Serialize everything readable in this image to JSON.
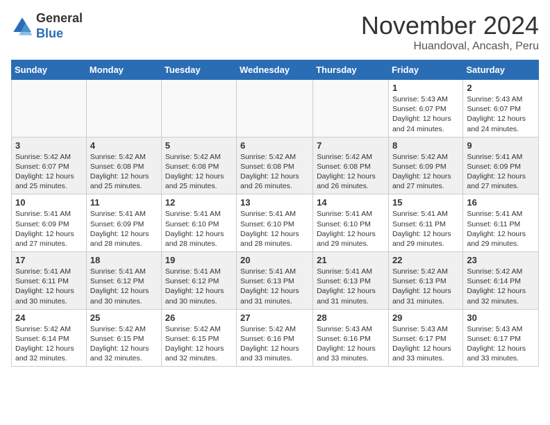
{
  "logo": {
    "general": "General",
    "blue": "Blue"
  },
  "title": "November 2024",
  "location": "Huandoval, Ancash, Peru",
  "weekdays": [
    "Sunday",
    "Monday",
    "Tuesday",
    "Wednesday",
    "Thursday",
    "Friday",
    "Saturday"
  ],
  "weeks": [
    [
      {
        "day": "",
        "info": ""
      },
      {
        "day": "",
        "info": ""
      },
      {
        "day": "",
        "info": ""
      },
      {
        "day": "",
        "info": ""
      },
      {
        "day": "",
        "info": ""
      },
      {
        "day": "1",
        "info": "Sunrise: 5:43 AM\nSunset: 6:07 PM\nDaylight: 12 hours and 24 minutes."
      },
      {
        "day": "2",
        "info": "Sunrise: 5:43 AM\nSunset: 6:07 PM\nDaylight: 12 hours and 24 minutes."
      }
    ],
    [
      {
        "day": "3",
        "info": "Sunrise: 5:42 AM\nSunset: 6:07 PM\nDaylight: 12 hours and 25 minutes."
      },
      {
        "day": "4",
        "info": "Sunrise: 5:42 AM\nSunset: 6:08 PM\nDaylight: 12 hours and 25 minutes."
      },
      {
        "day": "5",
        "info": "Sunrise: 5:42 AM\nSunset: 6:08 PM\nDaylight: 12 hours and 25 minutes."
      },
      {
        "day": "6",
        "info": "Sunrise: 5:42 AM\nSunset: 6:08 PM\nDaylight: 12 hours and 26 minutes."
      },
      {
        "day": "7",
        "info": "Sunrise: 5:42 AM\nSunset: 6:08 PM\nDaylight: 12 hours and 26 minutes."
      },
      {
        "day": "8",
        "info": "Sunrise: 5:42 AM\nSunset: 6:09 PM\nDaylight: 12 hours and 27 minutes."
      },
      {
        "day": "9",
        "info": "Sunrise: 5:41 AM\nSunset: 6:09 PM\nDaylight: 12 hours and 27 minutes."
      }
    ],
    [
      {
        "day": "10",
        "info": "Sunrise: 5:41 AM\nSunset: 6:09 PM\nDaylight: 12 hours and 27 minutes."
      },
      {
        "day": "11",
        "info": "Sunrise: 5:41 AM\nSunset: 6:09 PM\nDaylight: 12 hours and 28 minutes."
      },
      {
        "day": "12",
        "info": "Sunrise: 5:41 AM\nSunset: 6:10 PM\nDaylight: 12 hours and 28 minutes."
      },
      {
        "day": "13",
        "info": "Sunrise: 5:41 AM\nSunset: 6:10 PM\nDaylight: 12 hours and 28 minutes."
      },
      {
        "day": "14",
        "info": "Sunrise: 5:41 AM\nSunset: 6:10 PM\nDaylight: 12 hours and 29 minutes."
      },
      {
        "day": "15",
        "info": "Sunrise: 5:41 AM\nSunset: 6:11 PM\nDaylight: 12 hours and 29 minutes."
      },
      {
        "day": "16",
        "info": "Sunrise: 5:41 AM\nSunset: 6:11 PM\nDaylight: 12 hours and 29 minutes."
      }
    ],
    [
      {
        "day": "17",
        "info": "Sunrise: 5:41 AM\nSunset: 6:11 PM\nDaylight: 12 hours and 30 minutes."
      },
      {
        "day": "18",
        "info": "Sunrise: 5:41 AM\nSunset: 6:12 PM\nDaylight: 12 hours and 30 minutes."
      },
      {
        "day": "19",
        "info": "Sunrise: 5:41 AM\nSunset: 6:12 PM\nDaylight: 12 hours and 30 minutes."
      },
      {
        "day": "20",
        "info": "Sunrise: 5:41 AM\nSunset: 6:13 PM\nDaylight: 12 hours and 31 minutes."
      },
      {
        "day": "21",
        "info": "Sunrise: 5:41 AM\nSunset: 6:13 PM\nDaylight: 12 hours and 31 minutes."
      },
      {
        "day": "22",
        "info": "Sunrise: 5:42 AM\nSunset: 6:13 PM\nDaylight: 12 hours and 31 minutes."
      },
      {
        "day": "23",
        "info": "Sunrise: 5:42 AM\nSunset: 6:14 PM\nDaylight: 12 hours and 32 minutes."
      }
    ],
    [
      {
        "day": "24",
        "info": "Sunrise: 5:42 AM\nSunset: 6:14 PM\nDaylight: 12 hours and 32 minutes."
      },
      {
        "day": "25",
        "info": "Sunrise: 5:42 AM\nSunset: 6:15 PM\nDaylight: 12 hours and 32 minutes."
      },
      {
        "day": "26",
        "info": "Sunrise: 5:42 AM\nSunset: 6:15 PM\nDaylight: 12 hours and 32 minutes."
      },
      {
        "day": "27",
        "info": "Sunrise: 5:42 AM\nSunset: 6:16 PM\nDaylight: 12 hours and 33 minutes."
      },
      {
        "day": "28",
        "info": "Sunrise: 5:43 AM\nSunset: 6:16 PM\nDaylight: 12 hours and 33 minutes."
      },
      {
        "day": "29",
        "info": "Sunrise: 5:43 AM\nSunset: 6:17 PM\nDaylight: 12 hours and 33 minutes."
      },
      {
        "day": "30",
        "info": "Sunrise: 5:43 AM\nSunset: 6:17 PM\nDaylight: 12 hours and 33 minutes."
      }
    ]
  ]
}
